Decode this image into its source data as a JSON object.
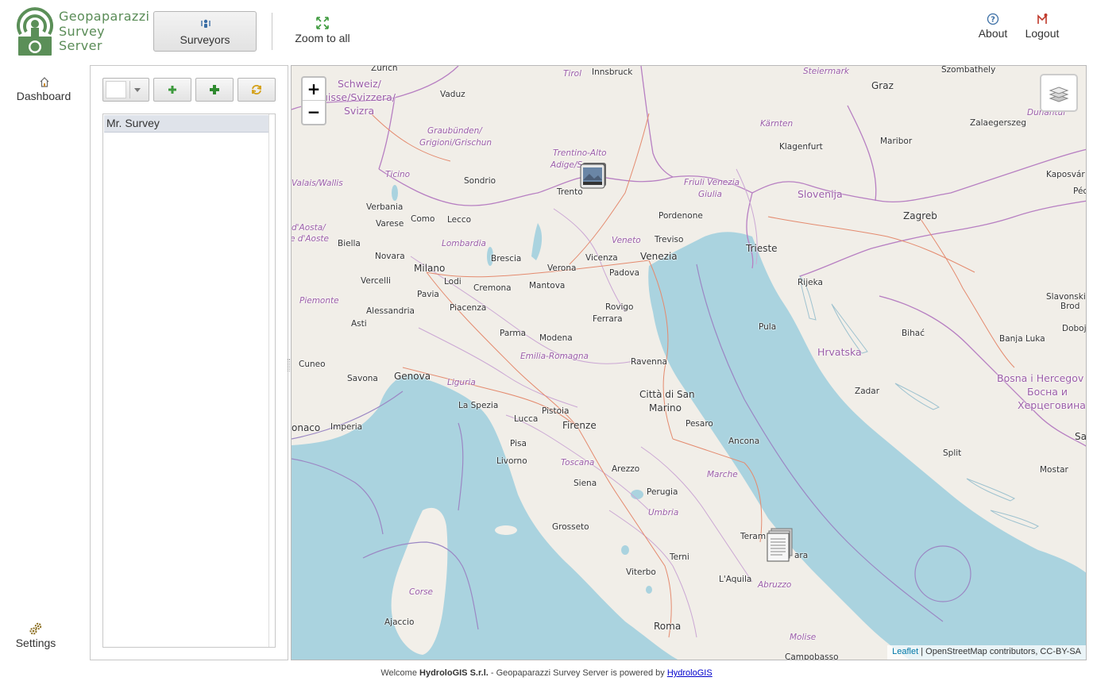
{
  "header": {
    "logo_text": "Geopaparazzi\nSurvey\nServer",
    "surveyors_label": "Surveyors",
    "zoom_label": "Zoom to all",
    "about_label": "About",
    "logout_label": "Logout"
  },
  "nav": {
    "dashboard_label": "Dashboard",
    "settings_label": "Settings"
  },
  "panel": {
    "color_value": "#ffffff",
    "surveyors": [
      "Mr. Survey"
    ]
  },
  "map": {
    "zoom_in": "+",
    "zoom_out": "−",
    "attribution_link": "Leaflet",
    "attribution_text": " | OpenStreetMap contributors, CC-BY-SA",
    "places": {
      "zurich": "Zurich",
      "innsbruck": "Innsbruck",
      "tirol": "Tirol",
      "steiermark": "Steiermark",
      "graz": "Graz",
      "szombathely": "Szombathely",
      "schweiz1": "Schweiz/",
      "schweiz2": "uisse/Svizzera/",
      "schweiz3": "Svizra",
      "vaduz": "Vaduz",
      "dunantul": "Dunántúl",
      "zalaegerszeg": "Zalaegerszeg",
      "karnten": "Kärnten",
      "klagenfurt": "Klagenfurt",
      "maribor": "Maribor",
      "graub1": "Graubünden/",
      "graub2": "Grigioni/Grischun",
      "trentino1": "Trentino-Alto",
      "trentino2": "Adige/S",
      "kaposvar": "Kaposvár",
      "ticino": "Ticino",
      "valais": "Valais/Wallis",
      "sondrio": "Sondrio",
      "trento": "Trento",
      "friuli1": "Friuli Venezia",
      "friuli2": "Giulia",
      "slovenija": "Slovenija",
      "pec": "Péc",
      "verbania": "Verbania",
      "como": "Como",
      "zagreb": "Zagreb",
      "lecco": "Lecco",
      "varese": "Varese",
      "pordenone": "Pordenone",
      "aosta1": "d'Aosta/",
      "aosta2": "e d'Aoste",
      "veneto": "Veneto",
      "treviso": "Treviso",
      "biella": "Biella",
      "lombardia": "Lombardia",
      "trieste": "Trieste",
      "novara": "Novara",
      "brescia": "Brescia",
      "vicenza": "Vicenza",
      "venezia": "Venezia",
      "milano": "Milano",
      "verona": "Verona",
      "padova": "Padova",
      "vercelli": "Vercelli",
      "lodi": "Lodi",
      "rijeka": "Rijeka",
      "cremona": "Cremona",
      "mantova": "Mantova",
      "slavonski1": "Slavonski",
      "slavonski2": "Brod",
      "pavia": "Pavia",
      "piemonte": "Piemonte",
      "rovigo": "Rovigo",
      "alessandria": "Alessandria",
      "piacenza": "Piacenza",
      "ferrara": "Ferrara",
      "asti": "Asti",
      "pula": "Pula",
      "doboj": "Doboj",
      "bihac": "Bihać",
      "parma": "Parma",
      "modena": "Modena",
      "banja": "Banja Luka",
      "hrvatska": "Hrvatska",
      "emilia": "Emilia-Romagna",
      "cuneo": "Cuneo",
      "ravenna": "Ravenna",
      "genova": "Genova",
      "savona": "Savona",
      "bosna1": "Bosna i Hercegov",
      "bosna2": "Босна и",
      "bosna3": "Херцеговина",
      "liguria": "Liguria",
      "zadar": "Zadar",
      "citta1": "Città di San",
      "citta2": "Marino",
      "laspezia": "La Spezia",
      "pistoia": "Pistoia",
      "pesaro": "Pesaro",
      "monaco": "onaco",
      "imperia": "Imperia",
      "firenze": "Firenze",
      "lucca": "Lucca",
      "sa": "Sa",
      "ancona": "Ancona",
      "pisa": "Pisa",
      "split": "Split",
      "livorno": "Livorno",
      "toscana": "Toscana",
      "arezzo": "Arezzo",
      "mostar": "Mostar",
      "marche": "Marche",
      "siena": "Siena",
      "perugia": "Perugia",
      "umbria": "Umbria",
      "grosseto": "Grosseto",
      "teramo": "Teram",
      "pescara": "ara",
      "terni": "Terni",
      "viterbo": "Viterbo",
      "laquila": "L'Aquila",
      "corse": "Corse",
      "abruzzo": "Abruzzo",
      "ajaccio": "Ajaccio",
      "roma": "Roma",
      "molise": "Molise",
      "campobasso": "Campobasso"
    }
  },
  "footer": {
    "welcome": "Welcome ",
    "company": "HydroloGIS S.r.l.",
    "powered": " - Geopaparazzi Survey Server is powered by ",
    "link": "HydroloGIS"
  }
}
